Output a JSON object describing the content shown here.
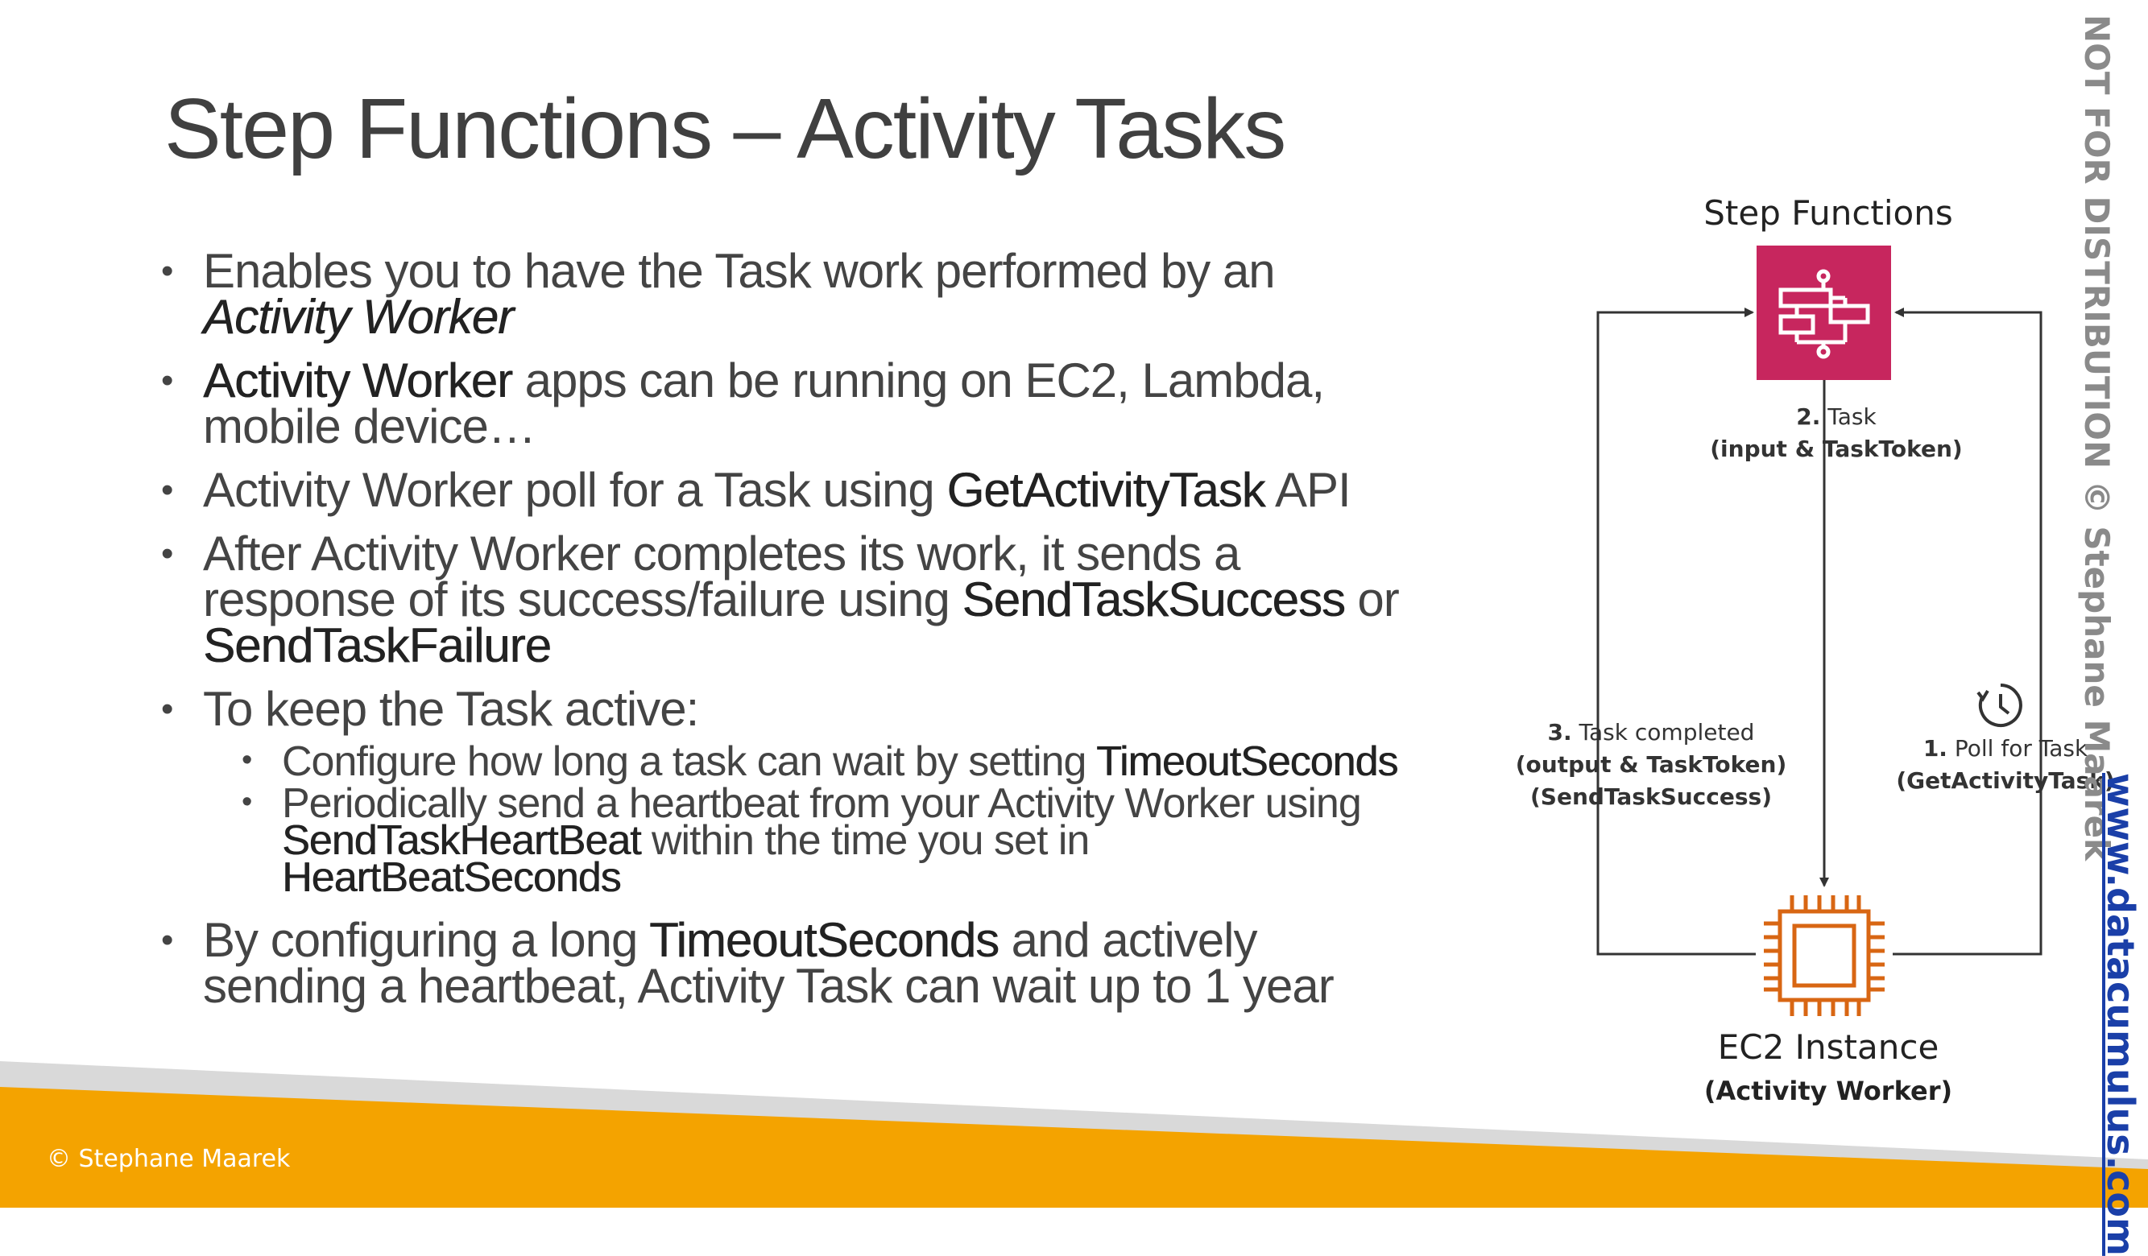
{
  "slide": {
    "title": "Step Functions – Activity Tasks",
    "bullets": [
      {
        "parts": [
          "Enables you to have the Task work performed by an ",
          "Activity Worker"
        ]
      },
      {
        "parts": [
          "Activity Worker",
          " apps can be running on EC2, Lambda, mobile device…"
        ]
      },
      {
        "parts": [
          "Activity Worker poll for a Task using ",
          "GetActivityTask",
          " API"
        ]
      },
      {
        "parts": [
          "After Activity Worker completes its work, it sends a response of its success/failure using ",
          "SendTaskSuccess",
          " or ",
          "SendTaskFailure"
        ]
      },
      {
        "parts": [
          "To keep the Task active:"
        ]
      },
      {
        "parts": [
          "By configuring a long ",
          "TimeoutSeconds",
          " and actively sending a heartbeat, Activity Task can wait up to 1 year"
        ]
      }
    ],
    "sub_bullets": [
      {
        "parts": [
          "Configure how long a task can wait by setting ",
          "TimeoutSeconds"
        ]
      },
      {
        "parts": [
          "Periodically send a heartbeat from your Activity Worker using ",
          "SendTaskHeartBeat",
          " within the time you set in ",
          "HeartBeatSeconds"
        ]
      }
    ]
  },
  "diagram": {
    "step_functions_label": "Step Functions",
    "ec2_label": "EC2 Instance",
    "ec2_sublabel": "(Activity Worker)",
    "step2": {
      "num": "2.",
      "text": " Task",
      "line2": "(input & TaskToken)"
    },
    "step3": {
      "num": "3.",
      "text": " Task completed",
      "line2": "(output & TaskToken)",
      "line3": "(SendTaskSuccess)"
    },
    "step1": {
      "num": "1.",
      "text": " Poll for Task",
      "line2": "(GetActivityTask)"
    },
    "icons": [
      "step-functions-icon",
      "ec2-chip-icon",
      "clock-icon"
    ],
    "colors": {
      "step_functions": "#c7265e",
      "ec2": "#d86613",
      "footer": "#f4a300"
    }
  },
  "watermark": "NOT FOR DISTRIBUTION © Stephane Maarek",
  "website": "www.datacumulus.com",
  "footer": "© Stephane Maarek"
}
